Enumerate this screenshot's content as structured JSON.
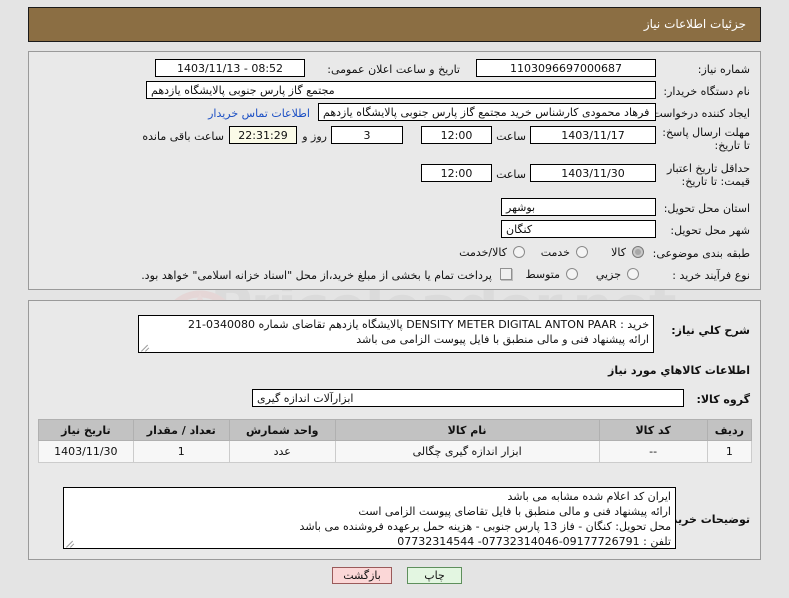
{
  "header": {
    "title": "جزئیات اطلاعات نیاز"
  },
  "form": {
    "need_number_label": "شماره نیاز:",
    "need_number_value": "1103096697000687",
    "announce_datetime_label": "تاریخ و ساعت اعلان عمومی:",
    "announce_datetime_value": "1403/11/13 - 08:52",
    "buyer_org_label": "نام دستگاه خریدار:",
    "buyer_org_value": "مجتمع گاز پارس جنوبی  پالایشگاه یازدهم",
    "creator_label": "ایجاد کننده درخواست:",
    "creator_value": "فرهاد محمودی کارشناس خرید مجتمع گاز پارس جنوبی  پالایشگاه یازدهم",
    "buyer_contact_link": "اطلاعات تماس خریدار",
    "deadline_label": "مهلت ارسال پاسخ: تا تاریخ:",
    "deadline_date": "1403/11/17",
    "hour_label": "ساعت",
    "deadline_time": "12:00",
    "days_value": "3",
    "days_label": "روز و",
    "countdown_value": "22:31:29",
    "countdown_label": "ساعت باقی مانده",
    "price_validity_label": "حداقل تاریخ اعتبار قیمت: تا تاریخ:",
    "price_validity_date": "1403/11/30",
    "price_validity_time": "12:00",
    "province_label": "استان محل تحویل:",
    "province_value": "بوشهر",
    "city_label": "شهر محل تحویل:",
    "city_value": "کنگان",
    "category_label": "طبقه بندی موضوعی:",
    "category_options": [
      {
        "label": "کالا",
        "selected": true
      },
      {
        "label": "خدمت",
        "selected": false
      },
      {
        "label": "کالا/خدمت",
        "selected": false
      }
    ],
    "process_label": "نوع فرآیند خرید :",
    "process_options": [
      {
        "label": "جزیي",
        "selected": false
      },
      {
        "label": "متوسط",
        "selected": false
      }
    ],
    "treasury_checkbox_text": "پرداخت تمام یا بخشی از مبلغ خرید،از محل \"اسناد خزانه اسلامی\" خواهد بود."
  },
  "description": {
    "label": "شرح کلي نیاز:",
    "lines": [
      "خرید : DENSITY METER DIGITAL ANTON PAAR  پالایشگاه یازدهم تقاضای شماره 0340080-21",
      "ارائه پیشنهاد فنی و مالی منطبق با فایل پیوست الزامی می باشد"
    ]
  },
  "goods_section": {
    "section_title": "اطلاعات کالاهاي مورد نیاز",
    "group_label": "گروه کالا:",
    "group_value": "ابزارآلات اندازه گیری",
    "table": {
      "headers": [
        "ردیف",
        "کد کالا",
        "نام کالا",
        "واحد شمارش",
        "تعداد / مقدار",
        "تاریخ نیاز"
      ],
      "rows": [
        {
          "row": "1",
          "code": "--",
          "name": "ابزار اندازه گیری چگالی",
          "unit": "عدد",
          "qty": "1",
          "need_date": "1403/11/30"
        }
      ]
    }
  },
  "buyer_notes": {
    "label": "توضیحات خریدار:",
    "lines": [
      "ایران کد اعلام شده مشابه می باشد",
      "ارائه پیشنهاد فنی و مالی منطبق با فایل تقاضای پیوست الزامی است",
      "محل تحویل: کنگان - فاز 13 پارس جنوبی - هزینه حمل برعهده فروشنده می باشد",
      "تلفن : 09177726791-07732314046- 07732314544"
    ]
  },
  "footer": {
    "print_label": "چاپ",
    "back_label": "بازگشت"
  },
  "watermark": {
    "text": "Priceleader.net"
  },
  "colors": {
    "title_bar": "#8b6e43",
    "page_bg": "#e4e4e4",
    "panel_bg": "#e9e9e9",
    "link": "#1b4fc4",
    "table_header": "#c2c2c2",
    "print_btn": "#e3f6e1",
    "back_btn": "#fbd7d7",
    "countdown_bg": "#fbfbe8"
  }
}
